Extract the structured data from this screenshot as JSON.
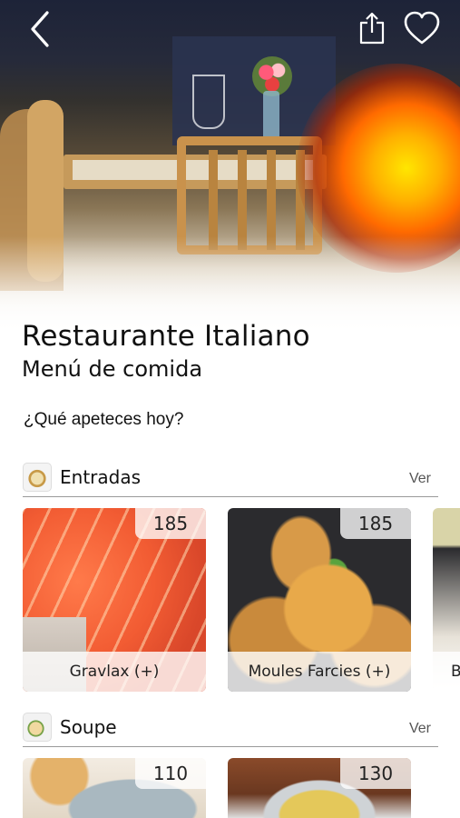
{
  "header": {
    "title": "Restaurante Italiano",
    "subtitle": "Menú de comida",
    "prompt": "¿Qué apeteces hoy?"
  },
  "nav": {
    "back_icon": "chevron-left-icon",
    "share_icon": "share-icon",
    "favorite_icon": "heart-icon"
  },
  "sections": [
    {
      "label": "Entradas",
      "link": "Ver",
      "icon": "dish-icon",
      "items": [
        {
          "name": "Gravlax (+)",
          "price": "185"
        },
        {
          "name": "Moules Farcies (+)",
          "price": "185"
        },
        {
          "name": "B"
        }
      ]
    },
    {
      "label": "Soupe",
      "link": "Ver",
      "icon": "soup-icon",
      "items": [
        {
          "price": "110"
        },
        {
          "price": "130"
        }
      ]
    }
  ],
  "colors": {
    "text": "#111111",
    "link": "#555555",
    "divider": "#9a9a9a"
  }
}
